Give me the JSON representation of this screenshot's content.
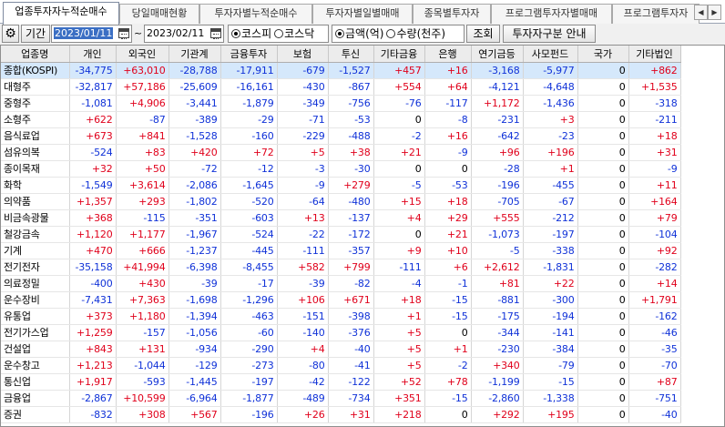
{
  "tabs": [
    {
      "label": "업종투자자누적순매수",
      "active": true
    },
    {
      "label": "당일매매현황",
      "active": false
    },
    {
      "label": "투자자별누적순매수",
      "active": false
    },
    {
      "label": "투자자별일별매매",
      "active": false
    },
    {
      "label": "종목별투자자",
      "active": false
    },
    {
      "label": "프로그램투자자별매매",
      "active": false
    },
    {
      "label": "프로그램투자자",
      "active": false
    }
  ],
  "toolbar": {
    "settings_icon": "gear-icon",
    "period_label": "기간",
    "start_date": "2023/01/11",
    "tilde": "~",
    "end_date": "2023/02/11",
    "market_options": [
      {
        "label": "코스피",
        "selected": true
      },
      {
        "label": "코스닥",
        "selected": false
      }
    ],
    "unit_options": [
      {
        "label": "금액(억)",
        "selected": true
      },
      {
        "label": "수량(천주)",
        "selected": false
      }
    ],
    "query_button": "조회",
    "investor_guide_button": "투자자구분 안내"
  },
  "colors": {
    "positive": "#e0001b",
    "negative": "#1032d8",
    "highlight_row": "#d5e8fb"
  },
  "table": {
    "columns": [
      "업종명",
      "개인",
      "외국인",
      "기관계",
      "금융투자",
      "보험",
      "투신",
      "기타금융",
      "은행",
      "연기금등",
      "사모펀드",
      "국가",
      "기타법인"
    ],
    "rows": [
      [
        "종합(KOSPI)",
        "-34,775",
        "+63,010",
        "-28,788",
        "-17,911",
        "-679",
        "-1,527",
        "+457",
        "+16",
        "-3,168",
        "-5,977",
        "0",
        "+862"
      ],
      [
        "대형주",
        "-32,817",
        "+57,186",
        "-25,609",
        "-16,161",
        "-430",
        "-867",
        "+554",
        "+64",
        "-4,121",
        "-4,648",
        "0",
        "+1,535"
      ],
      [
        "중형주",
        "-1,081",
        "+4,906",
        "-3,441",
        "-1,879",
        "-349",
        "-756",
        "-76",
        "-117",
        "+1,172",
        "-1,436",
        "0",
        "-318"
      ],
      [
        "소형주",
        "+622",
        "-87",
        "-389",
        "-29",
        "-71",
        "-53",
        "0",
        "-8",
        "-231",
        "+3",
        "0",
        "-211"
      ],
      [
        "음식료업",
        "+673",
        "+841",
        "-1,528",
        "-160",
        "-229",
        "-488",
        "-2",
        "+16",
        "-642",
        "-23",
        "0",
        "+18"
      ],
      [
        "섬유의복",
        "-524",
        "+83",
        "+420",
        "+72",
        "+5",
        "+38",
        "+21",
        "-9",
        "+96",
        "+196",
        "0",
        "+31"
      ],
      [
        "종이목재",
        "+32",
        "+50",
        "-72",
        "-12",
        "-3",
        "-30",
        "0",
        "0",
        "-28",
        "+1",
        "0",
        "-9"
      ],
      [
        "화학",
        "-1,549",
        "+3,614",
        "-2,086",
        "-1,645",
        "-9",
        "+279",
        "-5",
        "-53",
        "-196",
        "-455",
        "0",
        "+11"
      ],
      [
        "의약품",
        "+1,357",
        "+293",
        "-1,802",
        "-520",
        "-64",
        "-480",
        "+15",
        "+18",
        "-705",
        "-67",
        "0",
        "+164"
      ],
      [
        "비금속광물",
        "+368",
        "-115",
        "-351",
        "-603",
        "+13",
        "-137",
        "+4",
        "+29",
        "+555",
        "-212",
        "0",
        "+79"
      ],
      [
        "철강금속",
        "+1,120",
        "+1,177",
        "-1,967",
        "-524",
        "-22",
        "-172",
        "0",
        "+21",
        "-1,073",
        "-197",
        "0",
        "-104"
      ],
      [
        "기계",
        "+470",
        "+666",
        "-1,237",
        "-445",
        "-111",
        "-357",
        "+9",
        "+10",
        "-5",
        "-338",
        "0",
        "+92"
      ],
      [
        "전기전자",
        "-35,158",
        "+41,994",
        "-6,398",
        "-8,455",
        "+582",
        "+799",
        "-111",
        "+6",
        "+2,612",
        "-1,831",
        "0",
        "-282"
      ],
      [
        "의료정밀",
        "-400",
        "+430",
        "-39",
        "-17",
        "-39",
        "-82",
        "-4",
        "-1",
        "+81",
        "+22",
        "0",
        "+14"
      ],
      [
        "운수장비",
        "-7,431",
        "+7,363",
        "-1,698",
        "-1,296",
        "+106",
        "+671",
        "+18",
        "-15",
        "-881",
        "-300",
        "0",
        "+1,791"
      ],
      [
        "유통업",
        "+373",
        "+1,180",
        "-1,394",
        "-463",
        "-151",
        "-398",
        "+1",
        "-15",
        "-175",
        "-194",
        "0",
        "-162"
      ],
      [
        "전기가스업",
        "+1,259",
        "-157",
        "-1,056",
        "-60",
        "-140",
        "-376",
        "+5",
        "0",
        "-344",
        "-141",
        "0",
        "-46"
      ],
      [
        "건설업",
        "+843",
        "+131",
        "-934",
        "-290",
        "+4",
        "-40",
        "+5",
        "+1",
        "-230",
        "-384",
        "0",
        "-35"
      ],
      [
        "운수창고",
        "+1,213",
        "-1,044",
        "-129",
        "-273",
        "-80",
        "-41",
        "+5",
        "-2",
        "+340",
        "-79",
        "0",
        "-70"
      ],
      [
        "통신업",
        "+1,917",
        "-593",
        "-1,445",
        "-197",
        "-42",
        "-122",
        "+52",
        "+78",
        "-1,199",
        "-15",
        "0",
        "+87"
      ],
      [
        "금융업",
        "-2,867",
        "+10,599",
        "-6,964",
        "-1,877",
        "-489",
        "-734",
        "+351",
        "-15",
        "-2,860",
        "-1,338",
        "0",
        "-751"
      ],
      [
        "증권",
        "-832",
        "+308",
        "+567",
        "-196",
        "+26",
        "+31",
        "+218",
        "0",
        "+292",
        "+195",
        "0",
        "-40"
      ]
    ]
  }
}
